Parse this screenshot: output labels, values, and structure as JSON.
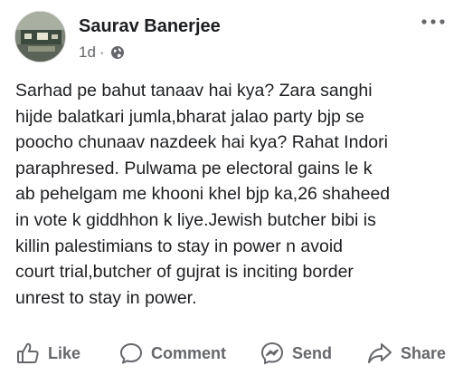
{
  "post": {
    "author": "Saurav Banerjee",
    "time": "1d",
    "separator": "·",
    "privacy_icon": "globe-icon",
    "more_icon": "more-options-icon",
    "text": "Sarhad pe bahut tanaav hai kya? Zara sanghi\nhijde balatkari jumla,bharat jalao party bjp se\npoocho chunaav nazdeek hai kya? Rahat Indori\nparaphresed. Pulwama pe electoral gains le k\nab pehelgam me khooni khel bjp ka,26 shaheed\nin vote k giddhhon k liye.Jewish butcher bibi is\nkillin palestimians to stay in power n avoid\ncourt trial,butcher of gujrat is inciting border\nunrest to stay in power."
  },
  "actions": {
    "like": {
      "label": "Like",
      "icon": "thumbs-up-icon"
    },
    "comment": {
      "label": "Comment",
      "icon": "comment-bubble-icon"
    },
    "send": {
      "label": "Send",
      "icon": "messenger-icon"
    },
    "share": {
      "label": "Share",
      "icon": "share-arrow-icon"
    }
  },
  "colors": {
    "text": "#1c1e21",
    "secondary": "#65676b",
    "background": "#ffffff"
  }
}
